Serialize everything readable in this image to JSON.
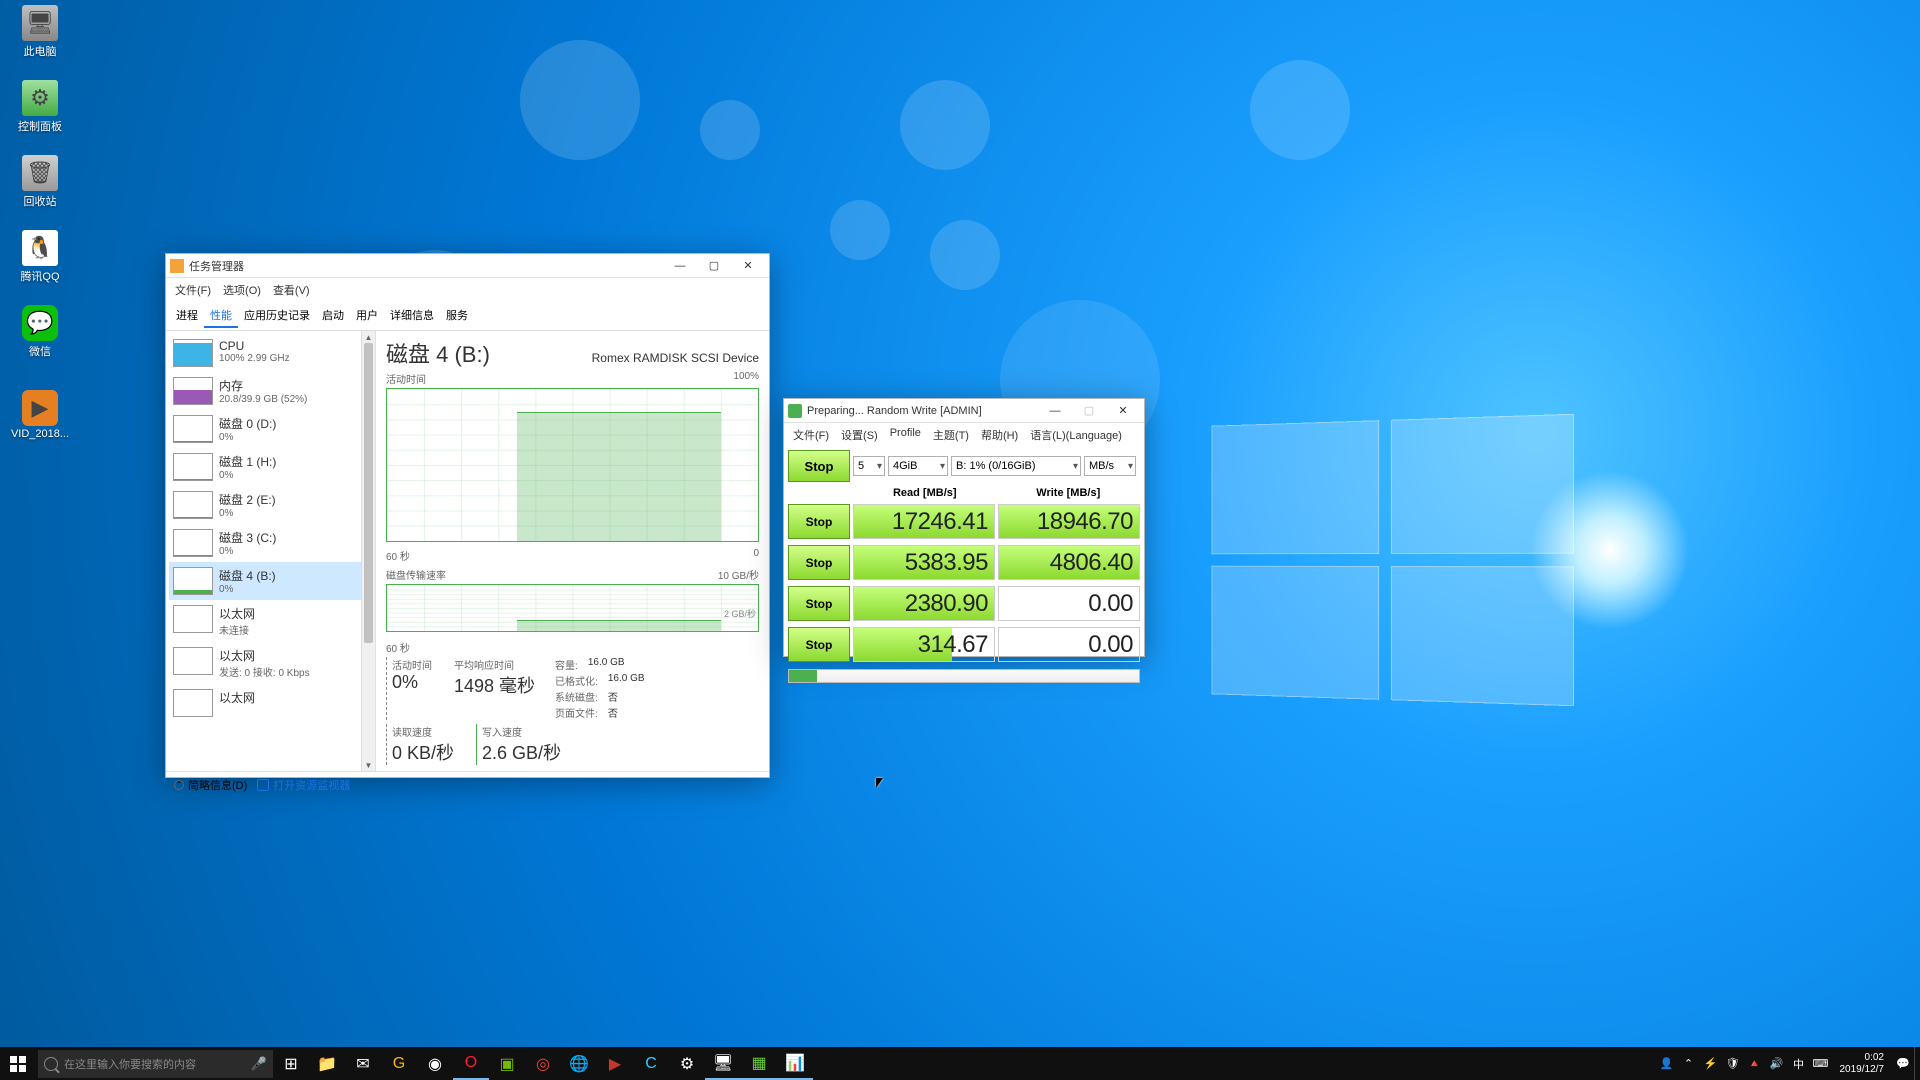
{
  "desktop_icons": [
    {
      "label": "此电脑"
    },
    {
      "label": "控制面板"
    },
    {
      "label": "回收站"
    },
    {
      "label": "腾讯QQ"
    },
    {
      "label": "微信"
    },
    {
      "label": "VID_2018..."
    }
  ],
  "taskmgr": {
    "title": "任务管理器",
    "menu": [
      "文件(F)",
      "选项(O)",
      "查看(V)"
    ],
    "tabs": [
      "进程",
      "性能",
      "应用历史记录",
      "启动",
      "用户",
      "详细信息",
      "服务"
    ],
    "active_tab": "性能",
    "sidebar": [
      {
        "name": "CPU",
        "sub": "100% 2.99 GHz",
        "kind": "cpu"
      },
      {
        "name": "内存",
        "sub": "20.8/39.9 GB (52%)",
        "kind": "mem"
      },
      {
        "name": "磁盘 0 (D:)",
        "sub": "0%",
        "kind": "disk"
      },
      {
        "name": "磁盘 1 (H:)",
        "sub": "0%",
        "kind": "disk"
      },
      {
        "name": "磁盘 2 (E:)",
        "sub": "0%",
        "kind": "disk"
      },
      {
        "name": "磁盘 3 (C:)",
        "sub": "0%",
        "kind": "disk"
      },
      {
        "name": "磁盘 4 (B:)",
        "sub": "0%",
        "kind": "diskactive",
        "selected": true
      },
      {
        "name": "以太网",
        "sub": "未连接",
        "kind": "eth"
      },
      {
        "name": "以太网",
        "sub": "发送: 0  接收: 0 Kbps",
        "kind": "eth"
      },
      {
        "name": "以太网",
        "sub": "",
        "kind": "eth"
      }
    ],
    "main": {
      "heading": "磁盘 4 (B:)",
      "device": "Romex RAMDISK SCSI Device",
      "chart1_label_left": "活动时间",
      "chart1_label_right": "100%",
      "chart1_axis_left": "60 秒",
      "chart1_axis_right": "0",
      "chart2_label_left": "磁盘传输速率",
      "chart2_label_right": "10 GB/秒",
      "chart2_axis_left": "60 秒",
      "chart2_mid": "2 GB/秒",
      "stats": [
        {
          "lbl": "活动时间",
          "val": "0%"
        },
        {
          "lbl": "平均响应时间",
          "val": "1498 毫秒"
        }
      ],
      "stats_r": [
        {
          "lbl": "容量:",
          "val": "16.0 GB"
        },
        {
          "lbl": "已格式化:",
          "val": "16.0 GB"
        },
        {
          "lbl": "系统磁盘:",
          "val": "否"
        },
        {
          "lbl": "页面文件:",
          "val": "否"
        }
      ],
      "stats2": [
        {
          "lbl": "读取速度",
          "val": "0 KB/秒"
        },
        {
          "lbl": "写入速度",
          "val": "2.6 GB/秒"
        }
      ]
    },
    "footer": {
      "fewer": "简略信息(D)",
      "rmon": "打开资源监视器"
    }
  },
  "cdm": {
    "title": "Preparing... Random Write [ADMIN]",
    "menu": [
      "文件(F)",
      "设置(S)",
      "Profile",
      "主题(T)",
      "帮助(H)",
      "语言(L)(Language)"
    ],
    "main_btn": "Stop",
    "runs": "5",
    "size": "4GiB",
    "target": "B: 1% (0/16GiB)",
    "unit": "MB/s",
    "head_read": "Read [MB/s]",
    "head_write": "Write [MB/s]",
    "rows": [
      {
        "btn": "Stop",
        "read": "17246.41",
        "read_pct": 100,
        "write": "18946.70",
        "write_pct": 100
      },
      {
        "btn": "Stop",
        "read": "5383.95",
        "read_pct": 100,
        "write": "4806.40",
        "write_pct": 100
      },
      {
        "btn": "Stop",
        "read": "2380.90",
        "read_pct": 100,
        "write": "0.00",
        "write_pct": 0
      },
      {
        "btn": "Stop",
        "read": "314.67",
        "read_pct": 70,
        "write": "0.00",
        "write_pct": 0
      }
    ]
  },
  "taskbar": {
    "search_placeholder": "在这里输入你要搜索的内容",
    "clock_time": "0:02",
    "clock_date": "2019/12/7"
  },
  "chart_data": [
    {
      "type": "area",
      "title": "活动时间 (Disk Active Time %)",
      "xlabel": "seconds ago (60→0)",
      "ylabel": "%",
      "ylim": [
        0,
        100
      ],
      "x": [
        60,
        55,
        50,
        45,
        40,
        35,
        32,
        30,
        28,
        26,
        24,
        22,
        20,
        18,
        16,
        14,
        12,
        10,
        8,
        6,
        4,
        2,
        0
      ],
      "values": [
        0,
        0,
        0,
        0,
        0,
        0,
        85,
        80,
        85,
        78,
        84,
        77,
        85,
        80,
        85,
        80,
        85,
        80,
        85,
        85,
        85,
        85,
        0
      ]
    },
    {
      "type": "area",
      "title": "磁盘传输速率 (Disk Transfer Rate)",
      "xlabel": "seconds ago (60→0)",
      "ylabel": "GB/s",
      "ylim": [
        0,
        10
      ],
      "x": [
        60,
        55,
        50,
        45,
        40,
        35,
        30,
        25,
        20,
        15,
        10,
        5,
        0
      ],
      "values": [
        0,
        0,
        0,
        0,
        0,
        0,
        2.5,
        2.4,
        2.5,
        2.4,
        2.5,
        2.4,
        0
      ]
    }
  ]
}
